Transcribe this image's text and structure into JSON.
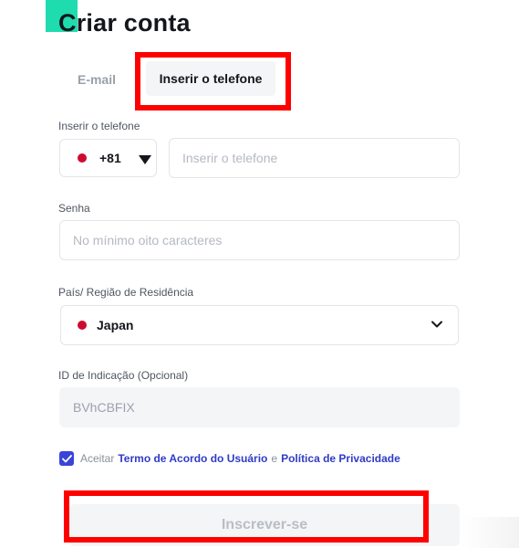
{
  "header": {
    "title": "Criar conta"
  },
  "tabs": {
    "email_label": "E-mail",
    "phone_label": "Inserir o telefone"
  },
  "phone": {
    "label": "Inserir o telefone",
    "country_code": "+81",
    "placeholder": "Inserir o telefone",
    "flag_icon": "japan-flag-icon"
  },
  "password": {
    "label": "Senha",
    "placeholder": "No mínimo oito caracteres"
  },
  "country": {
    "label": "País/ Região de Residência",
    "selected": "Japan"
  },
  "referral": {
    "label": "ID de Indicação (Opcional)",
    "value": "BVhCBFIX"
  },
  "agreement": {
    "checked": true,
    "prefix": "Aceitar",
    "terms_link": "Termo de Acordo do Usuário",
    "conjunction": "e",
    "privacy_link": "Política de Privacidade"
  },
  "submit": {
    "label": "Inscrever-se"
  },
  "colors": {
    "accent": "#1fdcae",
    "link": "#2f3bc6",
    "checkbox": "#3a45d6",
    "flag": "#cc0c2f",
    "highlight": "#ff0000"
  }
}
